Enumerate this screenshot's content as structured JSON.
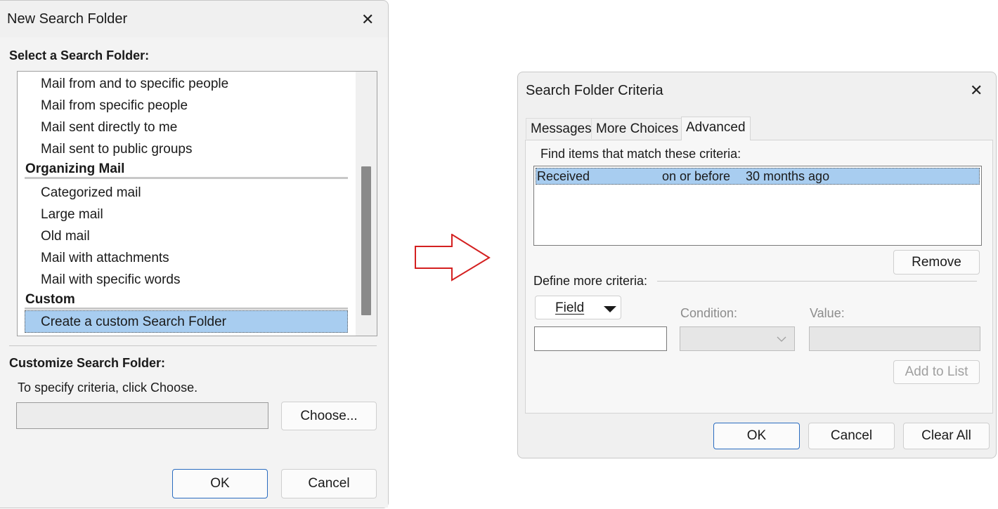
{
  "dialog1": {
    "title": "New Search Folder",
    "select_label": "Select a Search Folder:",
    "items_top": [
      "Mail from and to specific people",
      "Mail from specific people",
      "Mail sent directly to me",
      "Mail sent to public groups"
    ],
    "group_organizing": "Organizing Mail",
    "items_organizing": [
      "Categorized mail",
      "Large mail",
      "Old mail",
      "Mail with attachments",
      "Mail with specific words"
    ],
    "group_custom": "Custom",
    "selected_item": "Create a custom Search Folder",
    "customize_label": "Customize Search Folder:",
    "hint": "To specify criteria, click Choose.",
    "choose_label": "Choose...",
    "ok_label": "OK",
    "cancel_label": "Cancel"
  },
  "dialog2": {
    "title": "Search Folder Criteria",
    "tabs": [
      "Messages",
      "More Choices",
      "Advanced"
    ],
    "active_tab": "Advanced",
    "find_label": "Find items that match these criteria:",
    "criteria": [
      {
        "field": "Received",
        "condition": "on or before",
        "value": "30 months ago"
      }
    ],
    "remove_label": "Remove",
    "define_label": "Define more criteria:",
    "field_label": "Field",
    "condition_label": "Condition:",
    "value_label": "Value:",
    "add_label": "Add to List",
    "ok_label": "OK",
    "cancel_label": "Cancel",
    "clear_label": "Clear All"
  },
  "colors": {
    "selection": "#a8cdf0",
    "dialog_bg": "#f0f0f0",
    "arrow_outline": "#d42020",
    "primary_border": "#2a6cc0"
  }
}
